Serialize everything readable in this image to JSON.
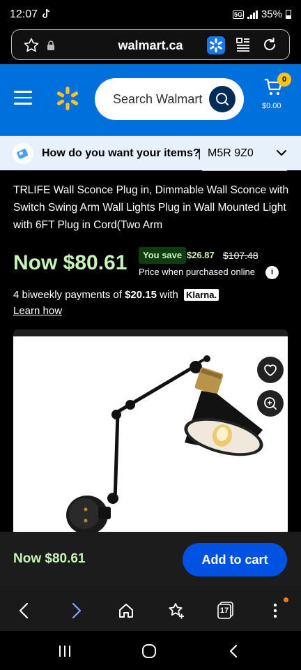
{
  "status": {
    "time": "12:07",
    "network": "5G",
    "battery": "35%"
  },
  "browser": {
    "url": "walmart.ca",
    "tabs_count": "17"
  },
  "header": {
    "search_placeholder": "Search Walmart",
    "cart_count": "0",
    "cart_total": "$0.00"
  },
  "delivery": {
    "question": "How do you want your items?",
    "separator": "|",
    "postal_code": "M5R 9Z0"
  },
  "product": {
    "title": "TRLIFE Wall Sconce Plug in, Dimmable Wall Sconce with Switch Swing Arm Wall Lights Plug in Wall Mounted Light with 6FT Plug in Cord(Two Arm",
    "now_price": "Now $80.61",
    "you_save_label": "You save",
    "save_amount": "$26.87",
    "was_price": "$107.48",
    "price_note": "Price when purchased online",
    "info_symbol": "i",
    "installments_prefix": "4 biweekly payments of",
    "installment_amount": "$20.15",
    "installments_with": "with",
    "klarna": "Klarna.",
    "learn_how": "Learn how"
  },
  "sticky": {
    "price": "Now $80.61",
    "add_to_cart": "Add to cart"
  },
  "colors": {
    "walmart_blue": "#0071dc",
    "spark_yellow": "#ffc220",
    "price_green": "#c5f2b6",
    "cta_blue": "#0053e2"
  }
}
